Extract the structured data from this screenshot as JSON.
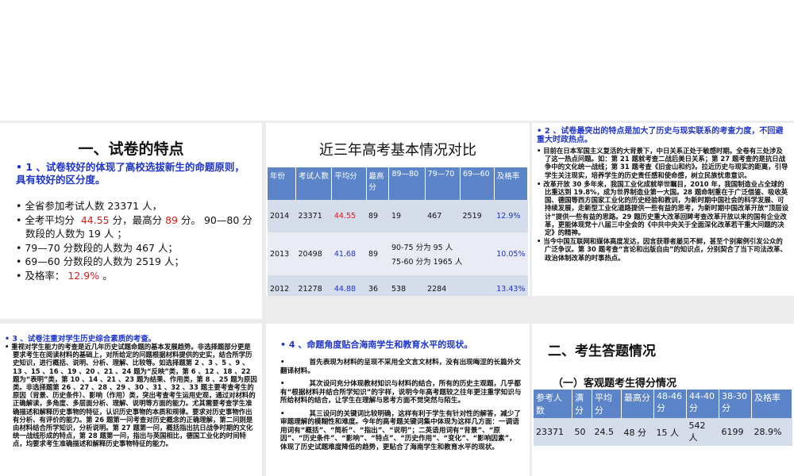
{
  "panel1": {
    "title": "一、试卷的特点",
    "subhead": "1 、试卷较好的体现了高校选拔新生的命题原则，具有较好的区分度。",
    "stat1": "全省参加考试人数 23371 人，",
    "stat2_a": "全考平均分",
    "stat2_avg": "44.55",
    "stat2_b": "分，最高分",
    "stat2_max": "89",
    "stat2_c": "分。 90—80 分数段的人数为 19 人 ；",
    "stat3": "79—70 分数段的人数为 467 人；",
    "stat4": "69—60 分数段的人数为 2519 人；",
    "stat5_a": "及格率：",
    "stat5_pct": "12.9%",
    "stat5_b": "。"
  },
  "panel2": {
    "title": "近三年高考基本情况对比",
    "headers": [
      "年份",
      "考试人数",
      "平均分",
      "最高分",
      "89—80",
      "79—70",
      "69—60",
      "及格率"
    ],
    "rows": [
      [
        "2014",
        "23371",
        "44.55",
        "89",
        "19",
        "467",
        "2519",
        "12.9%"
      ],
      [
        "2013",
        "20498",
        "41.68",
        "89",
        "90-75 分为 95 人",
        "75-60  分为 1965 人",
        "10.05%"
      ],
      [
        "2012",
        "21278",
        "44.88",
        "36",
        "538",
        "2284",
        "13.43%"
      ]
    ]
  },
  "panel3": {
    "subhead": "2 、试卷最突出的特点是加大了历史与现实联系的考查力度，不回避重大时政热点。",
    "p1": "目前在日本军国主义复活的大背景下，中日关系正处于敏感时期。全卷有三处涉及了这一热点问题。如：第 21 题就考查二战后美日关系；第 27 题考查的是抗日战争中的文化统一战线；第 31 题考查《旧金山和约》。拉近历史与现实的距离，引导学生关注现实，培养学生的历史责任感和使命感，树立民族忧患意识。",
    "p2": "改革开放 30 多年来，我国工业化成就举世瞩目，2010 年，我国制造业占全球的比重达到 19.8%，成为世界制造业第一大国。28 题命制重在于广泛借鉴、吸收英国、德国等西方国家工业化的历史经验和教训，为新时期中国社会的科学发展、可持续发展，走新型工业化道路提供一些有益的思考，为新时期中国改革开放“顶层设计”提供一些有益的思路。29 题历史重大改革回眸考查改革开放以来的国有企业改革，更能体现党十八届三中全会的《中共中央关于全面深化改革若干重大问题的决定》的精神。",
    "p3": "当今中国互联网和媒体高度发达，因言获罪者屡见不鲜，甚至个别案例引发公众的广泛争议。第 30 题考查“言论和出版自由”的知识点，分别契合了当下司法改革、政治体制改革的时事热点。"
  },
  "panel4": {
    "subhead": "3 、试卷注重对学生历史综合素质的考查。",
    "p1": "重视对学生能力的考查是近几年历史试题命题的基本发展趋势。非选择题部分更是要求考生在阅读材料的基础上，对所给定的问题根据材料提供的史实，结合所学历史知识，进行概括、说明、分析、理解、比较等。如选择题第 2 、3 、5 、9 、13 、15 、16 、19 、20 、21 、24 题为“反映”类，第 6 、12 、18 、22 题为“表明”类，第 10 、14 、21 、23 题为结果、作用类，第 8 、25 题为原因类。非选择题第 26 、27 、28 、29 、30 、31 、32 、33 题主要考查考生的原因（背景、历史条件）、影响（作用）类，突出考查考生运用史观，通过对材料的正确解读，多角度、多层面分析、理解、说明等方面的能力。尤其需要考查学生准确描述和解释历史事物的特征，认识历史事物的本质和规律。要求对历史事物作出有分析、有评价的能力。第 26 题第一问考查对历史概念的正确理解，第二问则是由材料结合所学知识，分析说明。第 27 题第一问，概括指出抗日战争时期的文化统一战线形成的特点，第 28 题第一问，指出与英国相比，德国工业化的时间特点，均要求考生准确描述和解释历史事物特征的能力。"
  },
  "panel5": {
    "subhead": "4 、命题角度贴合海南学生和教育水平的现状。",
    "p1": "首先表现为材料的呈现不采用全文言文材料，没有出现晦涩的长篇外文翻译材料。",
    "p2": "其次设问充分体现教材知识与材料的结合，所有的历史主观题，几乎都有“根据材料并结合所学知识”的字样，说明今年高考题较之往年更注重学知识与所给材料的结合，让学生在理解与思考方面不觉突然与陌生。",
    "p3": "其三设问的关键词比较明确，这样有利于学生有针对性的解答，减少了审题理解的模糊性和难度。今年的高考题关键词集中体现为这样几方面：一调语用词有“概括”、“简析”、“指出”、“说明”；二英语用词有“背景”、“原因”、“历史条件”、“影响”、“特点”、“历史作用”、“变化”、“影响因素”，体现了历史试题难度降低的趋势，更贴合了海南学生和教育水平的现状。"
  },
  "panel6": {
    "title": "二、考生答题情况",
    "sub": "（一）客观题考生得分情况",
    "headers": [
      "参考人数",
      "满分",
      "平均分",
      "最高分",
      "48-46分",
      "44-40分",
      "38-30分",
      "及格率"
    ],
    "row": [
      "23371",
      "50",
      "24.5",
      "48 分",
      "15 人",
      "542 人",
      "6199",
      "28.9%"
    ]
  }
}
